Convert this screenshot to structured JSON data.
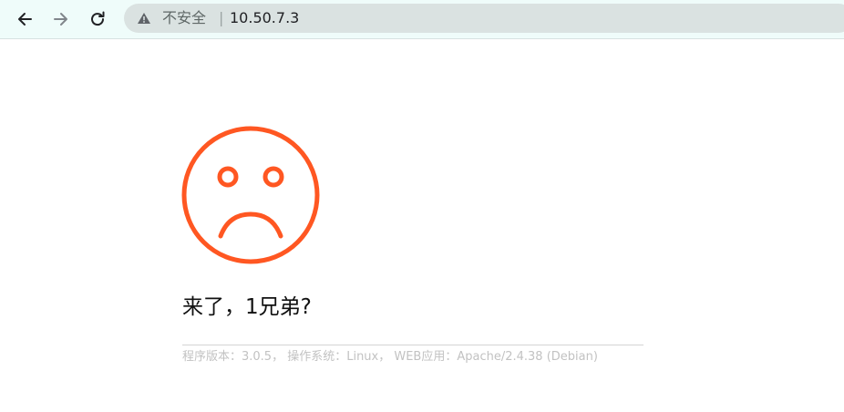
{
  "browser": {
    "security_label": "不安全",
    "divider": "|",
    "url": "10.50.7.3",
    "icons": {
      "back": "back-arrow-icon",
      "forward": "forward-arrow-icon",
      "reload": "reload-icon",
      "warning": "warning-triangle-icon"
    }
  },
  "page": {
    "face_icon": "sad-face-icon",
    "face_color": "#ff5722",
    "headline": "来了，1兄弟?",
    "footer": "程序版本：3.0.5， 操作系统：Linux， WEB应用：Apache/2.4.38 (Debian)"
  }
}
